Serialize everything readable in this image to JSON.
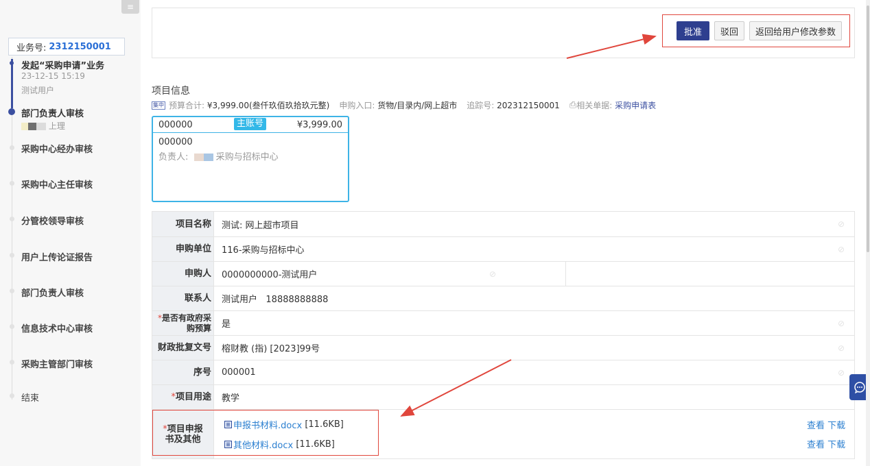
{
  "sidebar": {
    "collapse_icon": "≡",
    "business_label": "业务号:",
    "business_number": "2312150001",
    "steps": [
      {
        "title": "发起“采购申请”业务",
        "time": "23-12-15 15:19",
        "user": "测试用户",
        "status": "done"
      },
      {
        "title": "部门负责人审核",
        "user": "上理",
        "status": "current"
      },
      {
        "title": "采购中心经办审核",
        "status": "pending"
      },
      {
        "title": "采购中心主任审核",
        "status": "pending"
      },
      {
        "title": "分管校领导审核",
        "status": "pending"
      },
      {
        "title": "用户上传论证报告",
        "status": "pending"
      },
      {
        "title": "部门负责人审核",
        "status": "pending"
      },
      {
        "title": "信息技术中心审核",
        "status": "pending"
      },
      {
        "title": "采购主管部门审核",
        "status": "pending"
      },
      {
        "title": "结束",
        "status": "pending"
      }
    ]
  },
  "actions": {
    "approve": "批准",
    "reject": "驳回",
    "return": "返回给用户修改参数"
  },
  "project_info": {
    "title": "项目信息",
    "tag": "集中",
    "budget_label": "预算合计:",
    "budget_value": "¥3,999.00(叁仟玖佰玖拾玖元整)",
    "entry_label": "申购入口:",
    "entry_value": "货物/目录内/网上超市",
    "trace_label": "追踪号:",
    "trace_value": "202312150001",
    "related_label": "相关单据:",
    "related_link": "采购申请表"
  },
  "account_card": {
    "code": "000000",
    "badge": "主账号",
    "amount": "¥3,999.00",
    "code2": "000000",
    "owner_label": "负责人:",
    "owner_dept": "采购与招标中心"
  },
  "form": {
    "project_name_label": "项目名称",
    "project_name": "测试: 网上超市项目",
    "unit_label": "申购单位",
    "unit": "116-采购与招标中心",
    "applicant_label": "申购人",
    "applicant": "0000000000-测试用户",
    "contact_label": "联系人",
    "contact": "测试用户   18888888888",
    "gov_budget_label": "是否有政府采购预算",
    "gov_budget": "是",
    "approval_label": "财政批复文号",
    "approval": "榕财教 (指) [2023]99号",
    "serial_label": "序号",
    "serial": "000001",
    "usage_label": "项目用途",
    "usage": "教学",
    "docs_label": "项目申报书及其他",
    "files": [
      {
        "name": "申报书材料.docx",
        "size": "[11.6KB]"
      },
      {
        "name": "其他材料.docx",
        "size": "[11.6KB]"
      }
    ],
    "view": "查看",
    "download": "下载"
  },
  "icons": {
    "disabled": "⊘",
    "chat": "chat-bubble-icon",
    "print": "⎙"
  },
  "colors": {
    "primary": "#2e3f8f",
    "highlight": "#e0463c",
    "link": "#2b7fd0",
    "badge": "#33b8e8"
  }
}
